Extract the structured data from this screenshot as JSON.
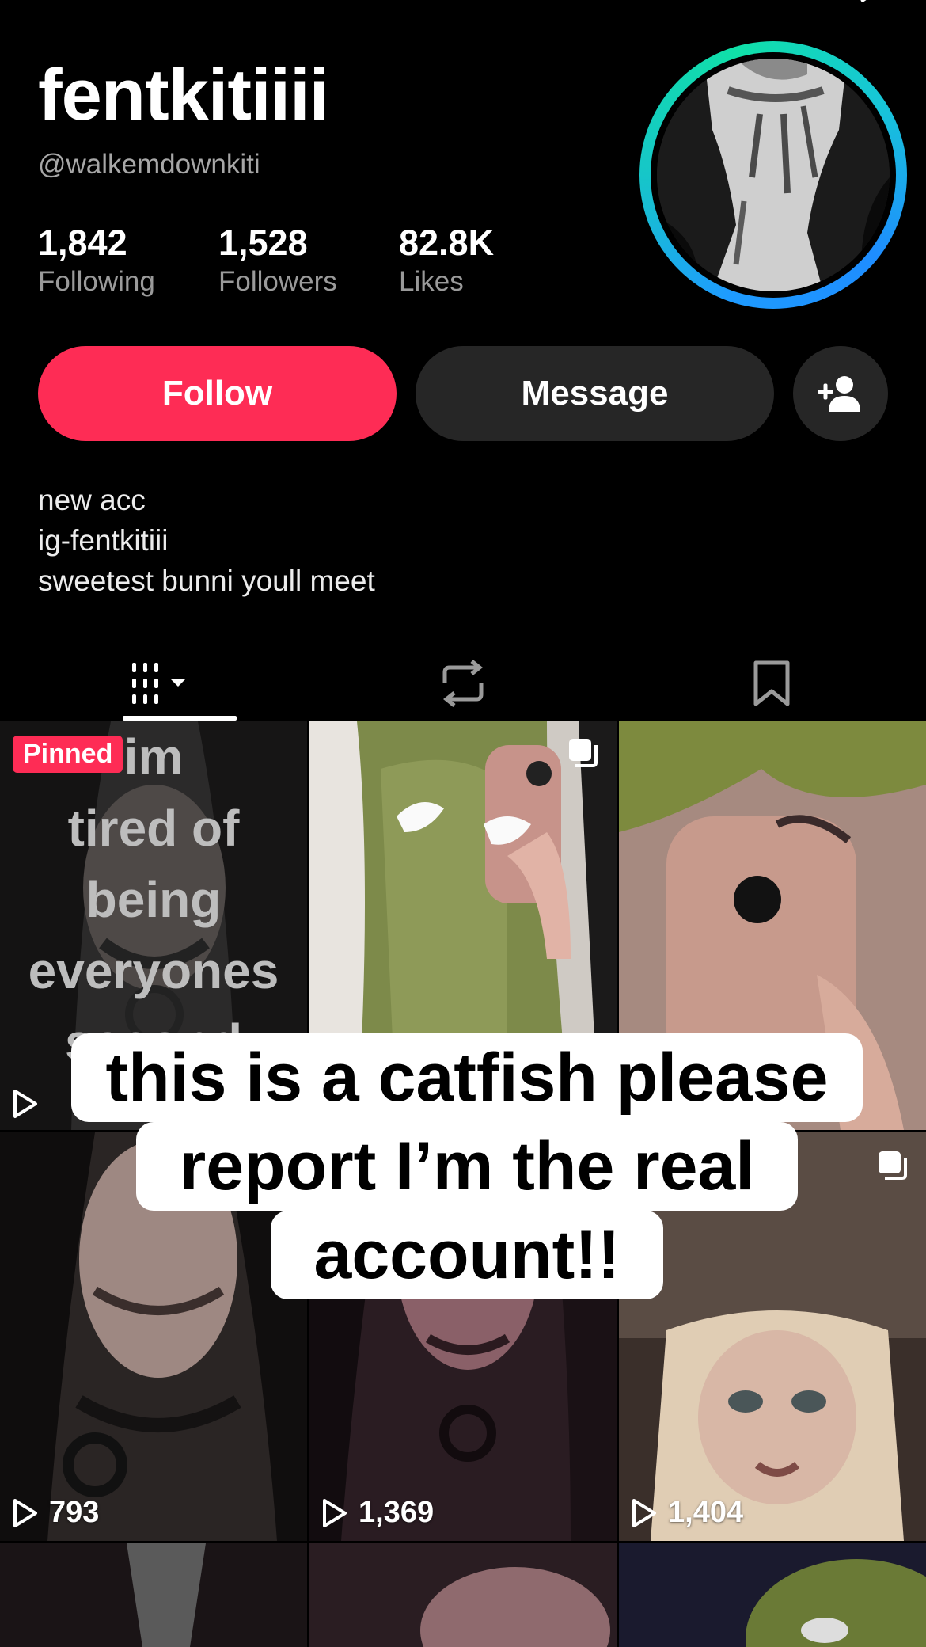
{
  "profile": {
    "display_name": "fentkitiiii",
    "handle": "@walkemdownkiti",
    "stats": {
      "following": {
        "value": "1,842",
        "label": "Following"
      },
      "followers": {
        "value": "1,528",
        "label": "Followers"
      },
      "likes": {
        "value": "82.8K",
        "label": "Likes"
      }
    },
    "bio": [
      "new acc",
      "ig-fentkitiii",
      "sweetest bunni youll meet"
    ]
  },
  "actions": {
    "follow": "Follow",
    "message": "Message"
  },
  "tabs": {
    "active": "videos",
    "icons": [
      "grid-icon",
      "repost-icon",
      "bookmark-icon"
    ]
  },
  "grid": {
    "pinned_label": "Pinned",
    "pinned_overlay": [
      "im",
      "tired of",
      "being",
      "everyones",
      "second"
    ],
    "views": [
      "793",
      "1,369",
      "1,404"
    ]
  },
  "overlay_caption": {
    "lines": [
      "this is a catfish please",
      "report I’m the real",
      "account!!"
    ]
  },
  "colors": {
    "accent": "#fe2c55",
    "button_dark": "#262626",
    "ring_start": "#1e9bff",
    "ring_end": "#10e0a8"
  }
}
